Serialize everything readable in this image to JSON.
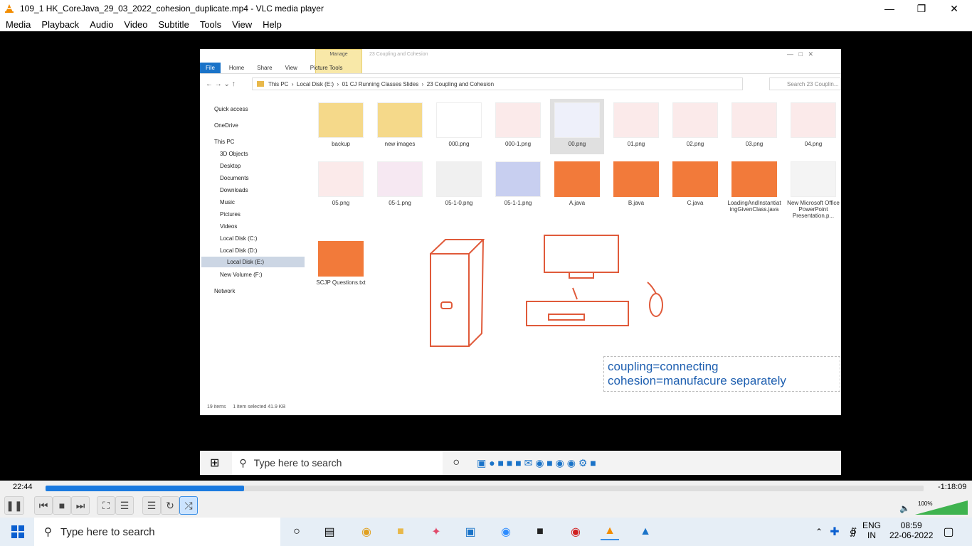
{
  "window": {
    "title": "109_1 HK_CoreJava_29_03_2022_cohesion_duplicate.mp4 - VLC media player"
  },
  "menu": [
    "Media",
    "Playback",
    "Audio",
    "Video",
    "Subtitle",
    "Tools",
    "View",
    "Help"
  ],
  "explorer": {
    "title": "23 Coupling and Cohesion",
    "manage_tab": "Manage",
    "picture_tools": "Picture Tools",
    "tabs": [
      "File",
      "Home",
      "Share",
      "View",
      "Picture Tools"
    ],
    "breadcrumb": [
      "This PC",
      "Local Disk (E:)",
      "01 CJ Running Classes Slides",
      "23 Coupling and Cohesion"
    ],
    "search_placeholder": "Search 23 Couplin...",
    "nav": [
      "Quick access",
      "OneDrive",
      "This PC",
      "3D Objects",
      "Desktop",
      "Documents",
      "Downloads",
      "Music",
      "Pictures",
      "Videos",
      "Local Disk (C:)",
      "Local Disk (D:)",
      "Local Disk (E:)",
      "New Volume (F:)",
      "Network"
    ],
    "files": [
      "backup",
      "new images",
      "000.png",
      "000-1.png",
      "00.png",
      "01.png",
      "02.png",
      "03.png",
      "04.png",
      "05.png",
      "05-1.png",
      "05-1-0.png",
      "05-1-1.png",
      "A.java",
      "B.java",
      "C.java",
      "LoadingAndInstantiatingGivenClass.java",
      "New Microsoft Office PowerPoint Presentation.p...",
      "SCJP Questions.txt"
    ],
    "status": [
      "19 items",
      "1 item selected  41.9 KB"
    ],
    "annotation": [
      "coupling=connecting",
      "cohesion=manufacure separately"
    ]
  },
  "inner_taskbar": {
    "search": "Type here to search"
  },
  "player": {
    "time_elapsed": "22:44",
    "time_remaining": "-1:18:09",
    "progress": 0.226,
    "volume": "100%"
  },
  "taskbar": {
    "search": "Type here to search",
    "lang": "ENG",
    "region": "IN",
    "time": "08:59",
    "date": "22-06-2022"
  }
}
